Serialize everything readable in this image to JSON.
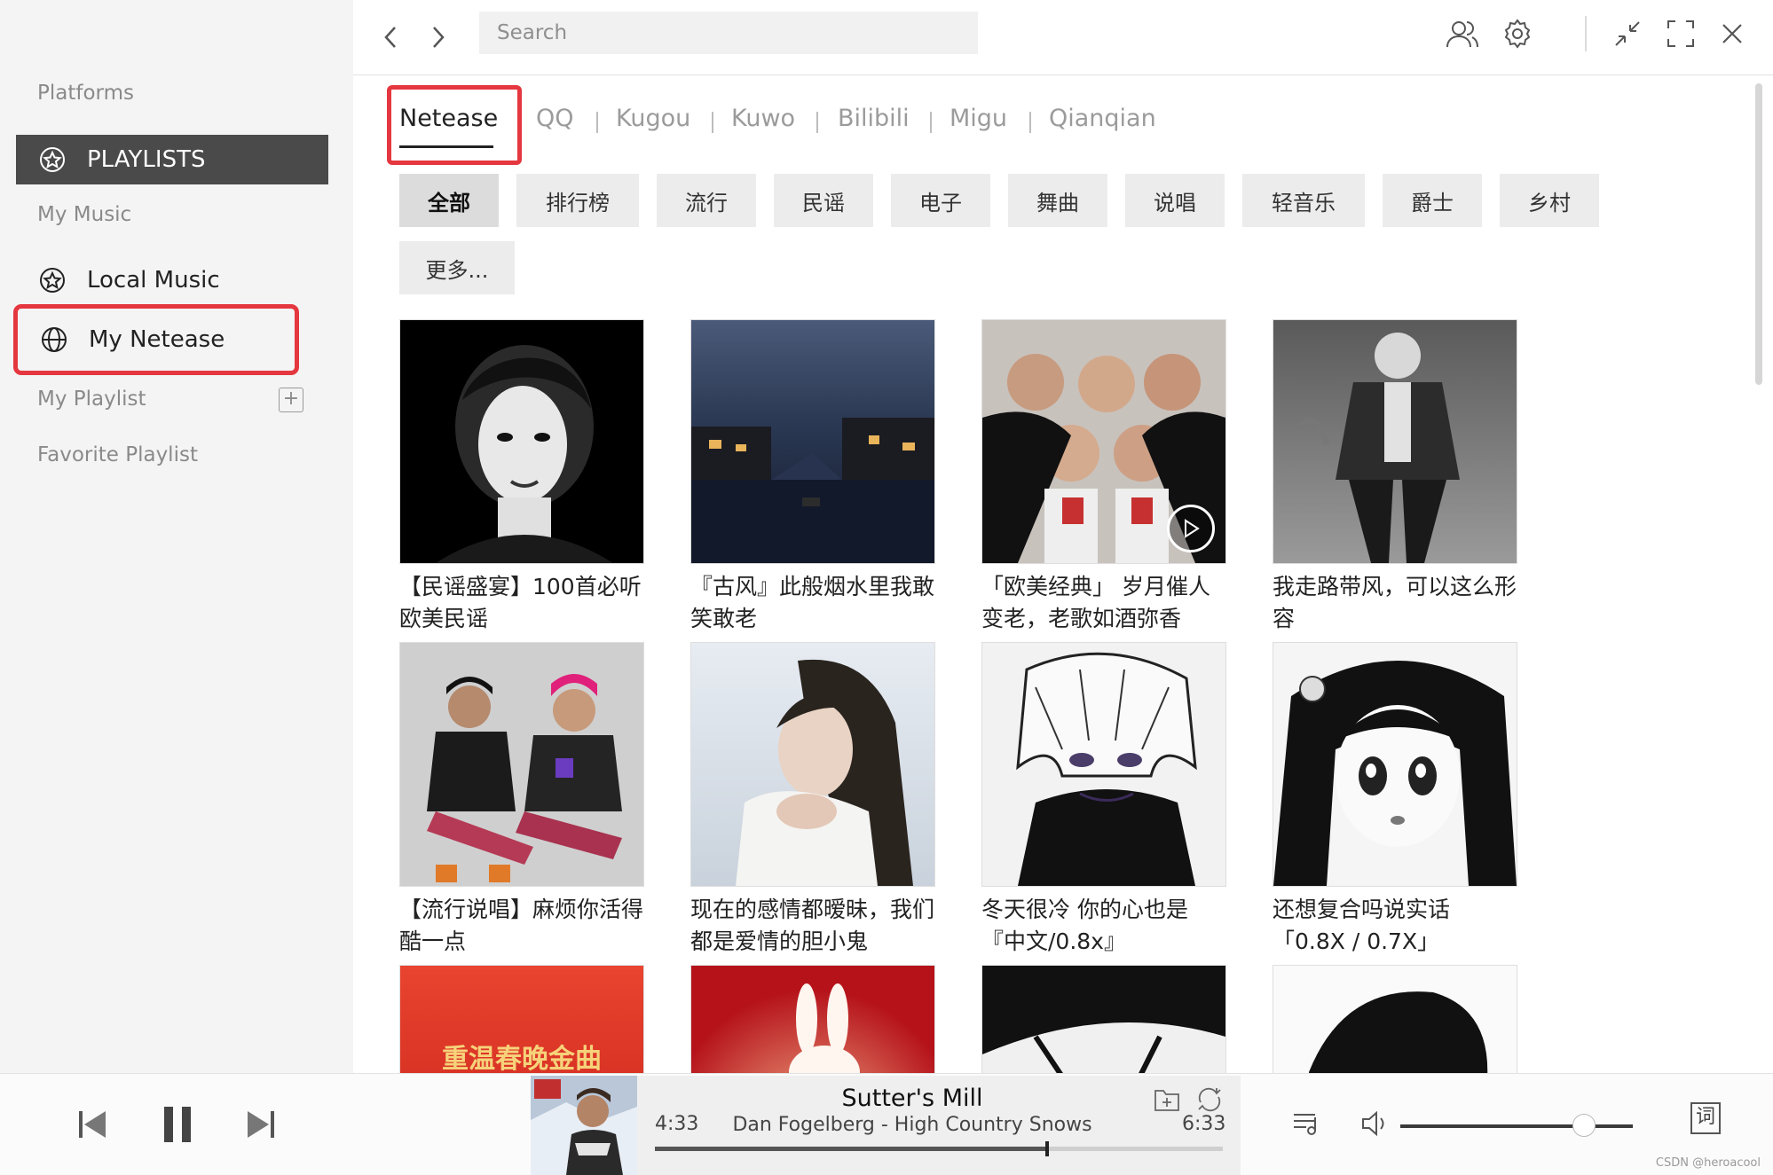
{
  "sidebar": {
    "platforms_label": "Platforms",
    "playlists_label": "PLAYLISTS",
    "my_music_label": "My Music",
    "local_music_label": "Local Music",
    "my_netease_label": "My Netease",
    "my_playlist_label": "My Playlist",
    "favorite_playlist_label": "Favorite Playlist"
  },
  "topbar": {
    "search_placeholder": "Search",
    "icons": [
      "chevron-left-icon",
      "chevron-right-icon",
      "users-icon",
      "gear-icon",
      "minimize-icon",
      "fullscreen-icon",
      "close-icon"
    ]
  },
  "tabs": [
    "Netease",
    "QQ",
    "Kugou",
    "Kuwo",
    "Bilibili",
    "Migu",
    "Qianqian"
  ],
  "categories": [
    "全部",
    "排行榜",
    "流行",
    "民谣",
    "电子",
    "舞曲",
    "说唱",
    "轻音乐",
    "爵士",
    "乡村",
    "更多..."
  ],
  "playlists": [
    {
      "title": "【民谣盛宴】100首必听欧美民谣"
    },
    {
      "title": "『古风』此般烟水里我敢笑敢老"
    },
    {
      "title": "「欧美经典」 岁月催人变老，老歌如酒弥香"
    },
    {
      "title": "我走路带风，可以这么形容"
    },
    {
      "title": "【流行说唱】麻烦你活得酷一点"
    },
    {
      "title": "现在的感情都暧昧，我们都是爱情的胆小鬼"
    },
    {
      "title": "冬天很冷 你的心也是『中文/0.8x』"
    },
    {
      "title": "还想复合吗说实话「0.8X / 0.7X」"
    }
  ],
  "third_row_cover_text": "重温春晚金曲",
  "player": {
    "title": "Sutter's Mill",
    "artist": "Dan Fogelberg - High Country Snows",
    "current_time": "4:33",
    "total_time": "6:33",
    "progress": 0.69,
    "volume": 0.79,
    "lyrics_label": "词"
  },
  "watermark": "CSDN @heroacool",
  "colors": {
    "accent_red": "#e5373f",
    "sidebar_active": "#4a4a4a"
  }
}
